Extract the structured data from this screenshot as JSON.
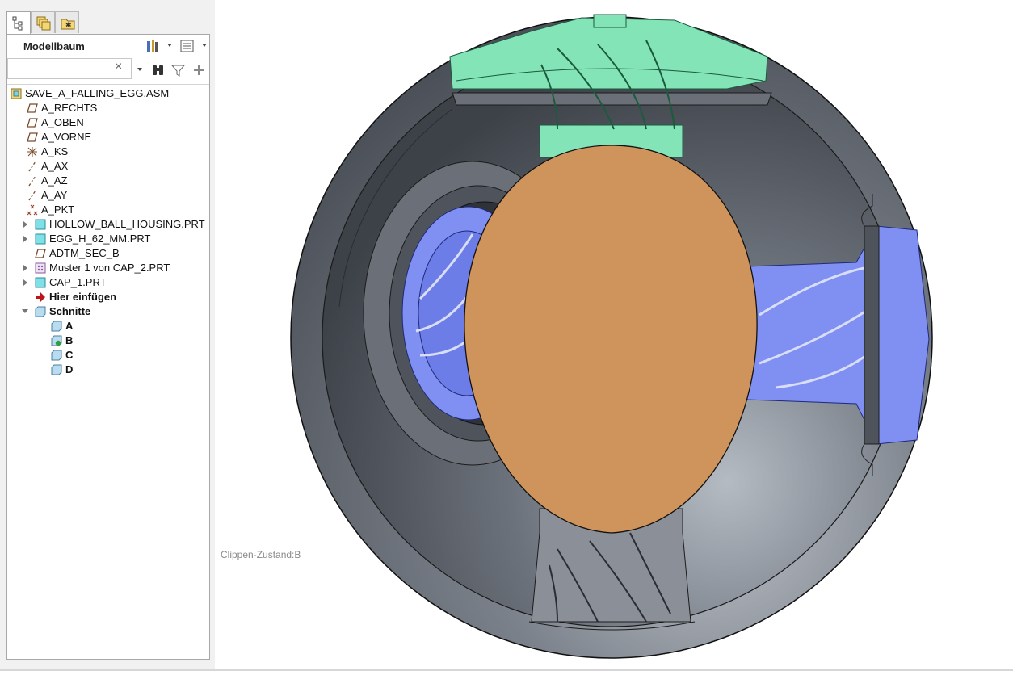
{
  "tabs": [
    {
      "icon": "model-tree-icon",
      "active": true
    },
    {
      "icon": "layers-icon",
      "active": false
    },
    {
      "icon": "favorites-folder-icon",
      "active": false
    }
  ],
  "tree_header": {
    "title": "Modellbaum"
  },
  "search": {
    "value": "",
    "clear_glyph": "×"
  },
  "tree": {
    "items": [
      {
        "label": "SAVE_A_FALLING_EGG.ASM",
        "icon": "assembly-icon"
      },
      {
        "label": "A_RECHTS",
        "icon": "datum-plane-icon"
      },
      {
        "label": "A_OBEN",
        "icon": "datum-plane-icon"
      },
      {
        "label": "A_VORNE",
        "icon": "datum-plane-icon"
      },
      {
        "label": "A_KS",
        "icon": "coordinate-system-icon"
      },
      {
        "label": "A_AX",
        "icon": "datum-axis-icon"
      },
      {
        "label": "A_AZ",
        "icon": "datum-axis-icon"
      },
      {
        "label": "A_AY",
        "icon": "datum-axis-icon"
      },
      {
        "label": "A_PKT",
        "icon": "datum-point-icon"
      },
      {
        "label": "HOLLOW_BALL_HOUSING.PRT",
        "icon": "part-icon"
      },
      {
        "label": "EGG_H_62_MM.PRT",
        "icon": "part-icon"
      },
      {
        "label": "ADTM_SEC_B",
        "icon": "datum-plane-icon"
      },
      {
        "label": "Muster 1 von CAP_2.PRT",
        "icon": "pattern-icon"
      },
      {
        "label": "CAP_1.PRT",
        "icon": "part-icon"
      },
      {
        "label": "Hier einfügen",
        "icon": "insert-here-arrow-icon"
      },
      {
        "label": "Schnitte",
        "icon": "sections-folder-icon"
      },
      {
        "label": "A",
        "icon": "section-icon"
      },
      {
        "label": "B",
        "icon": "active-section-icon"
      },
      {
        "label": "C",
        "icon": "section-icon"
      },
      {
        "label": "D",
        "icon": "section-icon"
      }
    ]
  },
  "viewport": {
    "status_text": "Clippen-Zustand:B"
  },
  "colors": {
    "housing": "#5f6570",
    "egg": "#cf945b",
    "cap_green": "#7de3b4",
    "cap_blue": "#7d8ef0",
    "panel_bg": "#f1f1f1"
  }
}
